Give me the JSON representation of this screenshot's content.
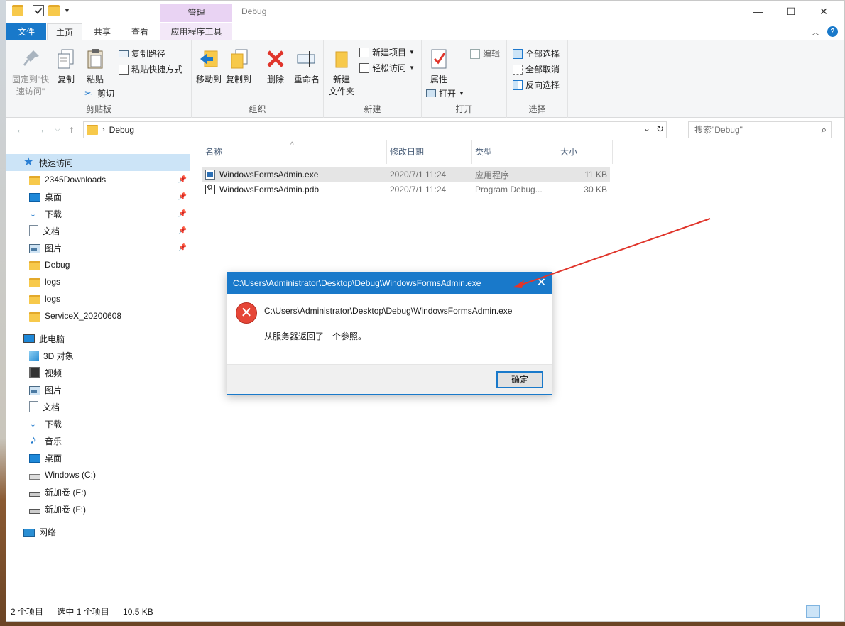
{
  "window": {
    "title": "Debug",
    "manage_tab": "管理",
    "minimize": "—",
    "maximize": "☐",
    "close": "✕"
  },
  "tabs": {
    "file": "文件",
    "home": "主页",
    "share": "共享",
    "view": "查看",
    "app_tools": "应用程序工具",
    "collapse": "︿",
    "help": "?"
  },
  "ribbon": {
    "clipboard": {
      "pin_line1": "固定到\"快",
      "pin_line2": "速访问\"",
      "copy": "复制",
      "paste": "粘贴",
      "copy_path": "复制路径",
      "paste_shortcut": "粘贴快捷方式",
      "cut": "剪切",
      "label": "剪贴板"
    },
    "organize": {
      "move_to": "移动到",
      "copy_to": "复制到",
      "delete": "删除",
      "rename": "重命名",
      "label": "组织"
    },
    "new": {
      "new_folder_line1": "新建",
      "new_folder_line2": "文件夹",
      "new_item": "新建项目",
      "easy_access": "轻松访问",
      "label": "新建"
    },
    "open": {
      "properties": "属性",
      "open": "打开",
      "edit": "编辑",
      "label": "打开"
    },
    "select": {
      "select_all": "全部选择",
      "select_none": "全部取消",
      "invert": "反向选择",
      "label": "选择"
    }
  },
  "address": {
    "path": "Debug",
    "search_placeholder": "搜索\"Debug\""
  },
  "nav": {
    "quick_access": "快速访问",
    "items": [
      {
        "label": "2345Downloads",
        "pinned": true
      },
      {
        "label": "桌面",
        "pinned": true
      },
      {
        "label": "下载",
        "pinned": true
      },
      {
        "label": "文档",
        "pinned": true
      },
      {
        "label": "图片",
        "pinned": true
      },
      {
        "label": "Debug",
        "pinned": false
      },
      {
        "label": "logs",
        "pinned": false
      },
      {
        "label": "logs",
        "pinned": false
      },
      {
        "label": "ServiceX_20200608",
        "pinned": false
      }
    ],
    "this_pc": "此电脑",
    "pc_items": [
      {
        "label": "3D 对象"
      },
      {
        "label": "视频"
      },
      {
        "label": "图片"
      },
      {
        "label": "文档"
      },
      {
        "label": "下载"
      },
      {
        "label": "音乐"
      },
      {
        "label": "桌面"
      },
      {
        "label": "Windows (C:)"
      },
      {
        "label": "新加卷 (E:)"
      },
      {
        "label": "新加卷 (F:)"
      }
    ],
    "network": "网络"
  },
  "files": {
    "columns": {
      "name": "名称",
      "modified": "修改日期",
      "type": "类型",
      "size": "大小"
    },
    "rows": [
      {
        "name": "WindowsFormsAdmin.exe",
        "modified": "2020/7/1 11:24",
        "type": "应用程序",
        "size": "11 KB"
      },
      {
        "name": "WindowsFormsAdmin.pdb",
        "modified": "2020/7/1 11:24",
        "type": "Program Debug...",
        "size": "30 KB"
      }
    ]
  },
  "status": {
    "count": "2 个项目",
    "selected": "选中 1 个项目",
    "size": "10.5 KB"
  },
  "dialog": {
    "title": "C:\\Users\\Administrator\\Desktop\\Debug\\WindowsFormsAdmin.exe",
    "close": "✕",
    "error_glyph": "✕",
    "path": "C:\\Users\\Administrator\\Desktop\\Debug\\WindowsFormsAdmin.exe",
    "message": "从服务器返回了一个参照。",
    "ok": "确定"
  },
  "colors": {
    "accent": "#1979ca",
    "error": "#e64637",
    "arrow": "#e0352b",
    "selection": "#cce4f7"
  }
}
